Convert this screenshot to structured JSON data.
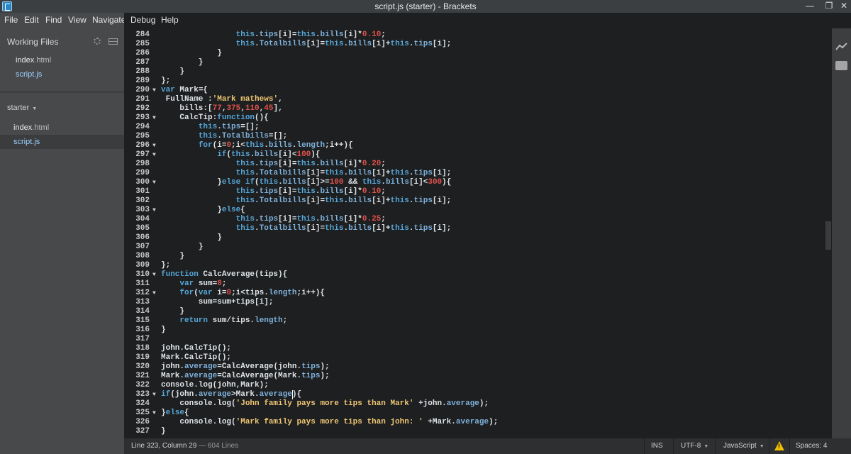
{
  "window": {
    "title": "script.js (starter) - Brackets",
    "controls": [
      "—",
      "❐",
      "✕"
    ]
  },
  "menu": [
    "File",
    "Edit",
    "Find",
    "View",
    "Navigate",
    "Debug",
    "Help"
  ],
  "sidebar": {
    "working_files_label": "Working Files",
    "working_files": [
      {
        "base": "index",
        "ext": ".html"
      },
      {
        "base": "script",
        "ext": ".js"
      }
    ],
    "project_label": "starter",
    "project_files": [
      {
        "base": "index",
        "ext": ".html"
      },
      {
        "base": "script",
        "ext": ".js"
      }
    ]
  },
  "editor": {
    "lines": [
      {
        "n": "284",
        "fold": "",
        "code": "                this.tips[i]=this.bills[i]*0.10;"
      },
      {
        "n": "285",
        "fold": "",
        "code": "                this.Totalbills[i]=this.bills[i]+this.tips[i];"
      },
      {
        "n": "286",
        "fold": "",
        "code": "            }"
      },
      {
        "n": "287",
        "fold": "",
        "code": "        }"
      },
      {
        "n": "288",
        "fold": "",
        "code": "    }"
      },
      {
        "n": "289",
        "fold": "",
        "code": "};"
      },
      {
        "n": "290",
        "fold": "▼",
        "code": "var Mark={"
      },
      {
        "n": "291",
        "fold": "",
        "code": " FullName :'Mark mathews',"
      },
      {
        "n": "292",
        "fold": "",
        "code": "    bills:[77,375,110,45],"
      },
      {
        "n": "293",
        "fold": "▼",
        "code": "    CalcTip:function(){"
      },
      {
        "n": "294",
        "fold": "",
        "code": "        this.tips=[];"
      },
      {
        "n": "295",
        "fold": "",
        "code": "        this.Totalbills=[];"
      },
      {
        "n": "296",
        "fold": "▼",
        "code": "        for(i=0;i<this.bills.length;i++){"
      },
      {
        "n": "297",
        "fold": "▼",
        "code": "            if(this.bills[i]<100){"
      },
      {
        "n": "298",
        "fold": "",
        "code": "                this.tips[i]=this.bills[i]*0.20;"
      },
      {
        "n": "299",
        "fold": "",
        "code": "                this.Totalbills[i]=this.bills[i]+this.tips[i];"
      },
      {
        "n": "300",
        "fold": "▼",
        "code": "            }else if(this.bills[i]>=100 && this.bills[i]<300){"
      },
      {
        "n": "301",
        "fold": "",
        "code": "                this.tips[i]=this.bills[i]*0.10;"
      },
      {
        "n": "302",
        "fold": "",
        "code": "                this.Totalbills[i]=this.bills[i]+this.tips[i];"
      },
      {
        "n": "303",
        "fold": "▼",
        "code": "            }else{"
      },
      {
        "n": "304",
        "fold": "",
        "code": "                this.tips[i]=this.bills[i]*0.25;"
      },
      {
        "n": "305",
        "fold": "",
        "code": "                this.Totalbills[i]=this.bills[i]+this.tips[i];"
      },
      {
        "n": "306",
        "fold": "",
        "code": "            }"
      },
      {
        "n": "307",
        "fold": "",
        "code": "        }"
      },
      {
        "n": "308",
        "fold": "",
        "code": "    }"
      },
      {
        "n": "309",
        "fold": "",
        "code": "};"
      },
      {
        "n": "310",
        "fold": "▼",
        "code": "function CalcAverage(tips){"
      },
      {
        "n": "311",
        "fold": "",
        "code": "    var sum=0;"
      },
      {
        "n": "312",
        "fold": "▼",
        "code": "    for(var i=0;i<tips.length;i++){"
      },
      {
        "n": "313",
        "fold": "",
        "code": "        sum=sum+tips[i];"
      },
      {
        "n": "314",
        "fold": "",
        "code": "    }"
      },
      {
        "n": "315",
        "fold": "",
        "code": "    return sum/tips.length;"
      },
      {
        "n": "316",
        "fold": "",
        "code": "}"
      },
      {
        "n": "317",
        "fold": "",
        "code": ""
      },
      {
        "n": "318",
        "fold": "",
        "code": "john.CalcTip();"
      },
      {
        "n": "319",
        "fold": "",
        "code": "Mark.CalcTip();"
      },
      {
        "n": "320",
        "fold": "",
        "code": "john.average=CalcAverage(john.tips);"
      },
      {
        "n": "321",
        "fold": "",
        "code": "Mark.average=CalcAverage(Mark.tips);"
      },
      {
        "n": "322",
        "fold": "",
        "code": "console.log(john,Mark);"
      },
      {
        "n": "323",
        "fold": "▼",
        "code": "if(john.average>Mark.average){"
      },
      {
        "n": "324",
        "fold": "",
        "code": "    console.log('John family pays more tips than Mark' +john.average);"
      },
      {
        "n": "325",
        "fold": "▼",
        "code": "}else{"
      },
      {
        "n": "326",
        "fold": "",
        "code": "    console.log('Mark family pays more tips than john: ' +Mark.average);"
      },
      {
        "n": "327",
        "fold": "",
        "code": "}"
      }
    ]
  },
  "status": {
    "position": "Line 323, Column 29",
    "lines": " — 604 Lines",
    "mode": "INS",
    "encoding": "UTF-8",
    "language": "JavaScript",
    "spaces": "Spaces: 4"
  },
  "colors": {
    "keyword": "#56a7d8",
    "string": "#f0c674",
    "number": "#e0524a",
    "warning": "#f0c000"
  }
}
